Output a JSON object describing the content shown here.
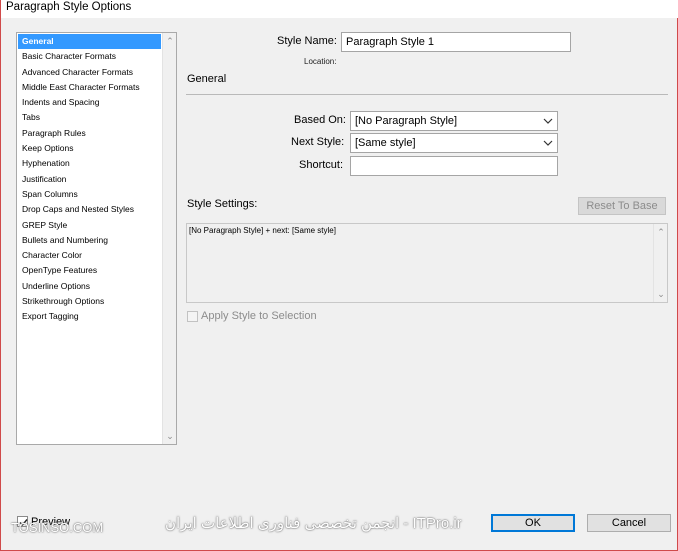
{
  "window": {
    "title": "Paragraph Style Options"
  },
  "categories": [
    {
      "label": "General",
      "selected": true
    },
    {
      "label": "Basic Character Formats"
    },
    {
      "label": "Advanced Character Formats"
    },
    {
      "label": "Middle East Character Formats"
    },
    {
      "label": "Indents and Spacing"
    },
    {
      "label": "Tabs"
    },
    {
      "label": "Paragraph Rules"
    },
    {
      "label": "Keep Options"
    },
    {
      "label": "Hyphenation"
    },
    {
      "label": "Justification"
    },
    {
      "label": "Span Columns"
    },
    {
      "label": "Drop Caps and Nested Styles"
    },
    {
      "label": "GREP Style"
    },
    {
      "label": "Bullets and Numbering"
    },
    {
      "label": "Character Color"
    },
    {
      "label": "OpenType Features"
    },
    {
      "label": "Underline Options"
    },
    {
      "label": "Strikethrough Options"
    },
    {
      "label": "Export Tagging"
    }
  ],
  "form": {
    "style_name_label": "Style Name:",
    "style_name_value": "Paragraph Style 1",
    "location_label": "Location:",
    "section_title": "General",
    "based_on_label": "Based On:",
    "based_on_value": "[No Paragraph Style]",
    "next_style_label": "Next Style:",
    "next_style_value": "[Same style]",
    "shortcut_label": "Shortcut:",
    "shortcut_value": "",
    "style_settings_label": "Style Settings:",
    "reset_to_base_label": "Reset To Base",
    "style_settings_text": "[No Paragraph Style] + next: [Same style]",
    "apply_style_label": "Apply Style to Selection",
    "apply_style_checked": false
  },
  "footer": {
    "preview_label": "Preview",
    "preview_checked": true,
    "ok_label": "OK",
    "cancel_label": "Cancel"
  },
  "watermark": {
    "left": "TOSINSO.COM",
    "right": "ITPro.ir - انجمن تخصصی فناوری اطلاعات ایران"
  }
}
